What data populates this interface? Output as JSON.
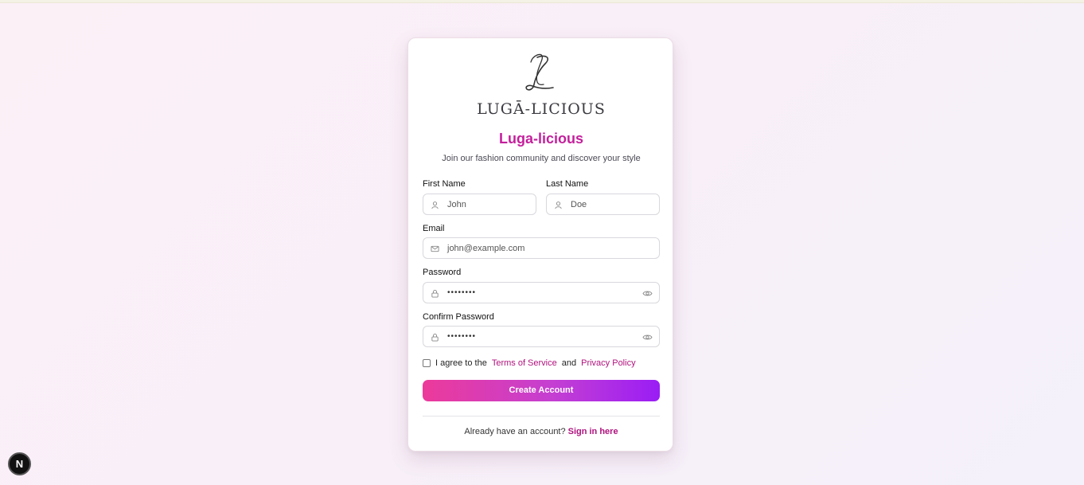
{
  "brand": {
    "logo_text": "LUGĀ-LICIOUS",
    "title": "Luga-licious",
    "subtitle": "Join our fashion community and discover your style"
  },
  "form": {
    "first_name": {
      "label": "First Name",
      "placeholder": "John",
      "icon": "user-icon"
    },
    "last_name": {
      "label": "Last Name",
      "placeholder": "Doe",
      "icon": "user-icon"
    },
    "email": {
      "label": "Email",
      "placeholder": "john@example.com",
      "icon": "mail-icon"
    },
    "password": {
      "label": "Password",
      "value": "••••••••",
      "icon": "lock-icon",
      "toggle_icon": "eye-icon"
    },
    "confirm_password": {
      "label": "Confirm Password",
      "value": "••••••••",
      "icon": "lock-icon",
      "toggle_icon": "eye-icon"
    },
    "agree": {
      "prefix": "I agree to the",
      "terms": "Terms of Service",
      "and": "and",
      "privacy": "Privacy Policy"
    },
    "submit_label": "Create Account"
  },
  "footer": {
    "text": "Already have an account?",
    "link": "Sign in here"
  },
  "dev_badge": {
    "label": "N"
  },
  "colors": {
    "accent": "#c41f9c",
    "link": "#b0127e",
    "button_start": "#ec3a9a",
    "button_end": "#9a1df5"
  }
}
